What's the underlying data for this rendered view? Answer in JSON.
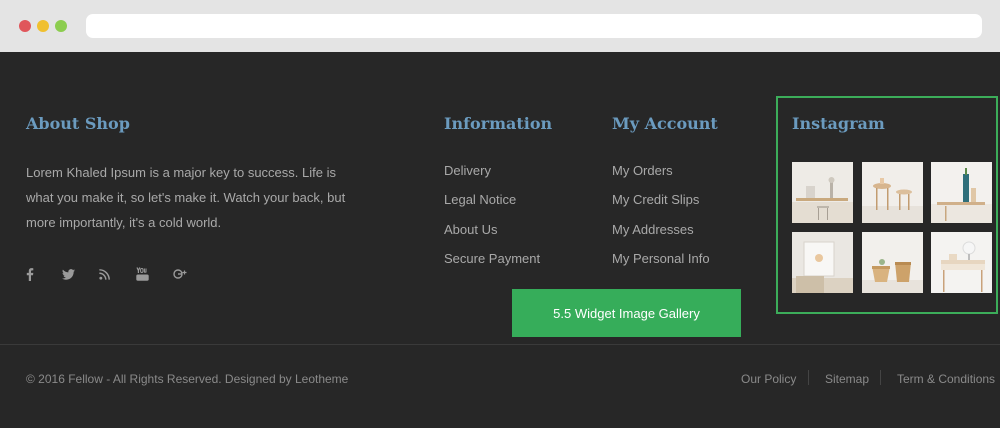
{
  "about": {
    "title": "About Shop",
    "text": "Lorem Khaled Ipsum is a major key to success. Life is what you make it, so let's make it. Watch your back, but more importantly, it's a cold world.",
    "socials": [
      "facebook-icon",
      "twitter-icon",
      "rss-icon",
      "youtube-icon",
      "google-plus-icon"
    ]
  },
  "information": {
    "title": "Information",
    "links": [
      "Delivery",
      "Legal Notice",
      "About Us",
      "Secure Payment"
    ]
  },
  "account": {
    "title": "My Account",
    "links": [
      "My Orders",
      "My Credit Slips",
      "My Addresses",
      "My Personal Info"
    ]
  },
  "instagram": {
    "title": "Instagram",
    "highlight_color": "#3cad5a"
  },
  "callout": {
    "label": "5.5 Widget Image Gallery",
    "color": "#36ad5a"
  },
  "bottom": {
    "copyright": "© 2016 Fellow - All Rights Reserved. Designed by Leotheme",
    "links": [
      "Our Policy",
      "Sitemap",
      "Term & Conditions"
    ]
  },
  "colors": {
    "heading": "#6b9bbf",
    "footer_bg": "#272727"
  }
}
